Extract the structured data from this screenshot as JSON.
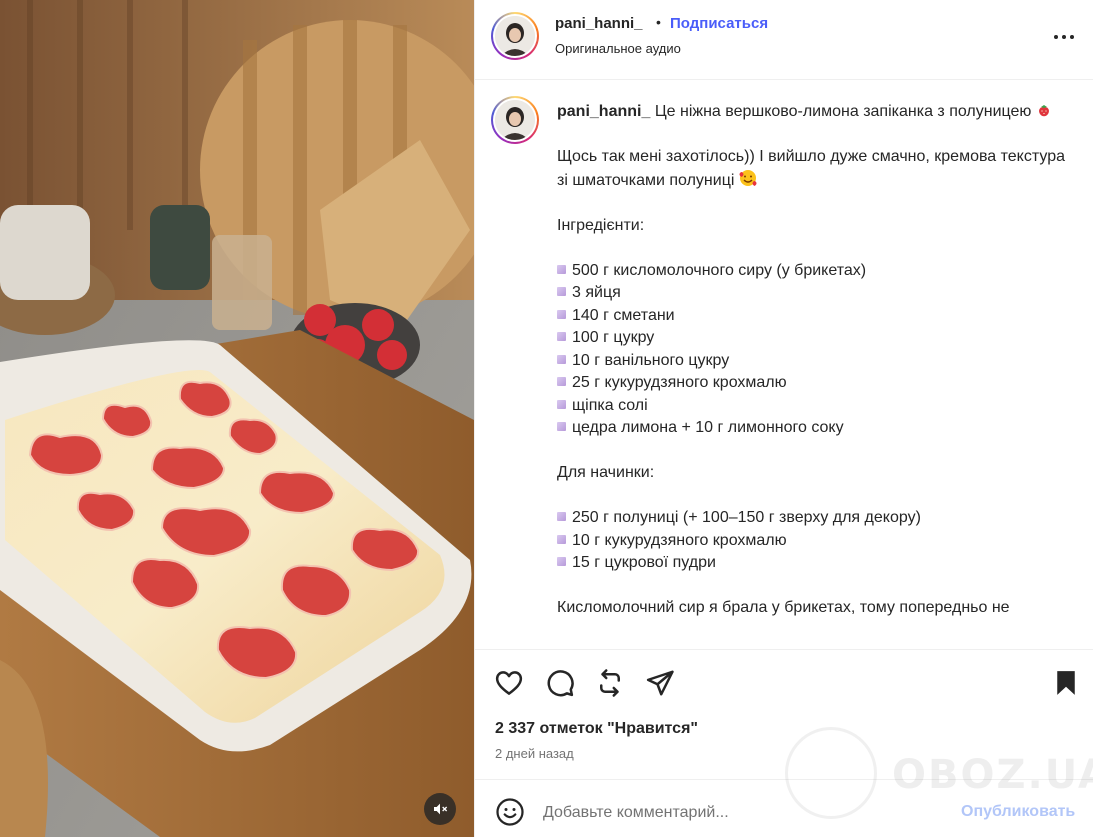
{
  "post": {
    "username": "pani_hanni_",
    "dot": "•",
    "follow_label": "Подписаться",
    "audio_label": "Оригинальное аудио"
  },
  "caption": {
    "username": "pani_hanni_",
    "intro": "Це ніжна вершково-лимона запіканка з полуницею",
    "line2": "Щось так мені захотілось)) І вийшло дуже смачно, кремова текстура зі шматочками полуниці",
    "ingredients_title": "Інгредієнти:",
    "ingredients": [
      "500 г кисломолочного сиру (у брикетах)",
      "3 яйця",
      "140 г сметани",
      "100 г цукру",
      "10 г ванільного цукру",
      "25 г кукурудзяного крохмалю",
      "щіпка солі",
      "цедра лимона + 10 г лимонного соку"
    ],
    "filling_title": "Для начинки:",
    "filling": [
      "250 г полуниці (+ 100–150 г зверху для декору)",
      "10 г кукурудзяного крохмалю",
      "15 г цукрової пудри"
    ],
    "tail": "Кисломолочний сир я брала у брикетах, тому попередньо не"
  },
  "stats": {
    "likes": "2 337 отметок \"Нравится\"",
    "time": "2 дней назад"
  },
  "comment": {
    "placeholder": "Добавьте комментарий...",
    "publish_label": "Опубликовать"
  },
  "watermark": {
    "text": "OBOZ.UA"
  },
  "icons": {
    "like": "heart-icon",
    "comment": "speech-bubble-icon",
    "repost": "repost-icon",
    "share": "paper-plane-icon",
    "save": "bookmark-icon",
    "mute": "muted-speaker-icon",
    "emoji": "smiley-icon",
    "more": "more-dots-icon"
  },
  "colors": {
    "follow": "#4a5df9",
    "publish_disabled": "#b2c6f8",
    "text": "#262626",
    "secondary": "#737373"
  }
}
